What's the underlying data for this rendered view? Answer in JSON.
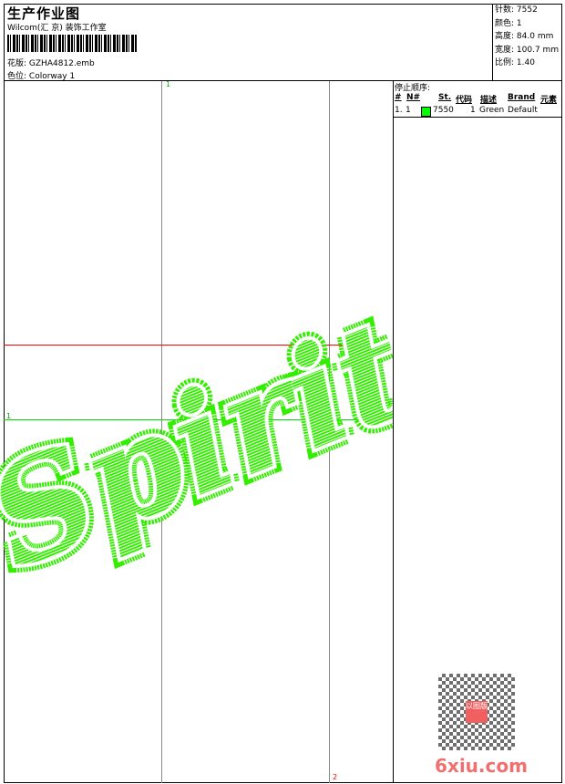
{
  "header": {
    "title": "生产作业图",
    "company": "Wilcom(汇 京) 装饰工作室",
    "design_label": "花版:",
    "design_value": "GZHA4812.emb",
    "colorway_label": "色位:",
    "colorway_value": "Colorway 1"
  },
  "info": [
    {
      "label": "针数:",
      "value": "7552"
    },
    {
      "label": "颜色:",
      "value": "1"
    },
    {
      "label": "高度:",
      "value": "84.0 mm"
    },
    {
      "label": "宽度:",
      "value": "100.7 mm"
    },
    {
      "label": "比例:",
      "value": "1.40"
    }
  ],
  "stop_sequence": {
    "title": "停止顺序:",
    "columns": [
      "#",
      "N#",
      "St.",
      "代码",
      "描述",
      "Brand",
      "元素"
    ],
    "rows": [
      {
        "index": "1.",
        "n": "1",
        "color": "#00ff00",
        "stitches": "7550",
        "code": "1",
        "description": "Green",
        "brand": "Default",
        "element": ""
      }
    ]
  },
  "canvas": {
    "design_text": "Spirit",
    "thread_color": "#33ee00",
    "markers": {
      "top": "1",
      "right": "2",
      "left": "1",
      "bottom": "2"
    },
    "guide_red": "#ff0000",
    "guide_green": "#00dd00"
  },
  "watermark": {
    "text": "6xiu.com",
    "seal": "以图版"
  }
}
